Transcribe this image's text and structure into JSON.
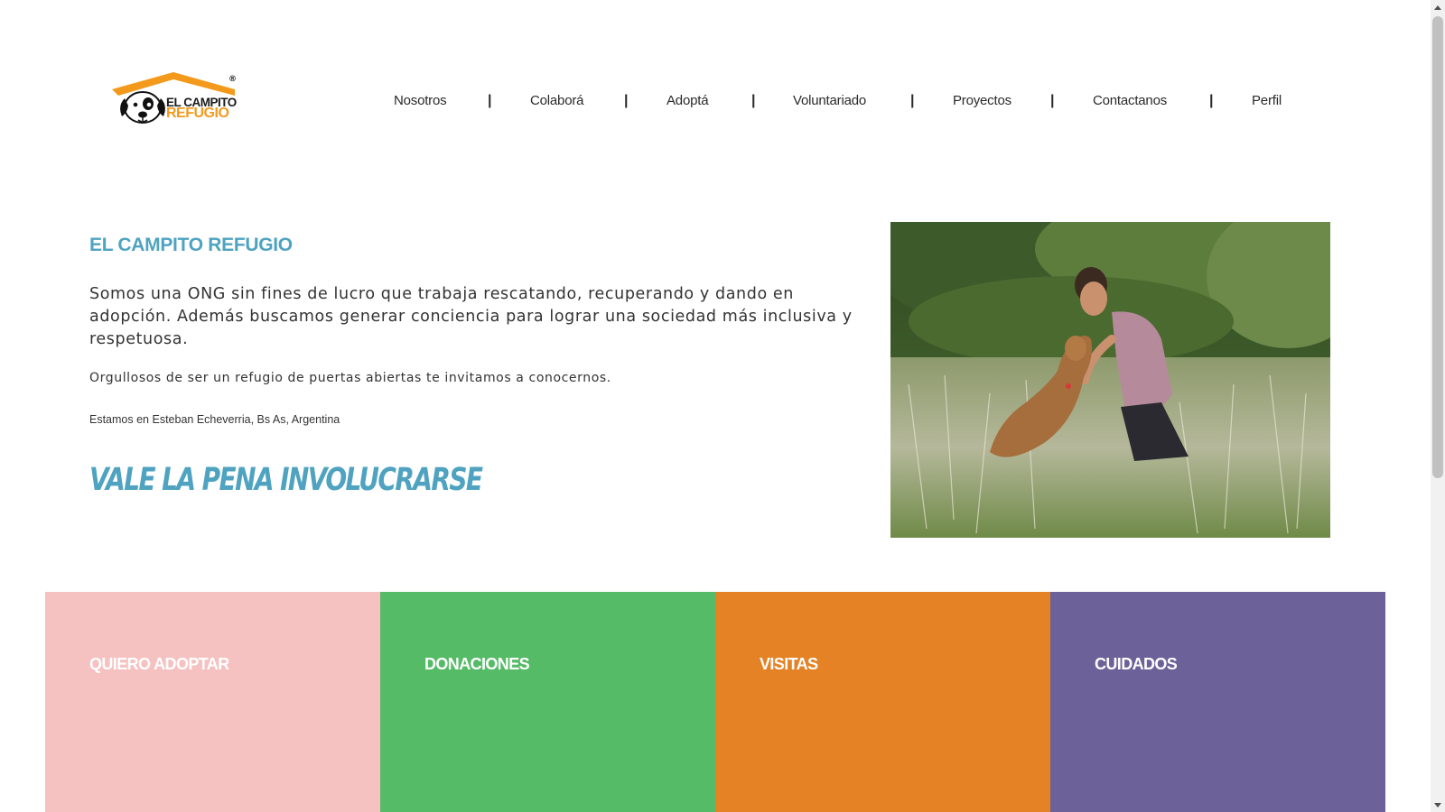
{
  "brand": {
    "line1": "EL CAMPITO",
    "line2": "REFUGIO",
    "registered": "®"
  },
  "nav": {
    "items": [
      {
        "label": "Nosotros"
      },
      {
        "label": "Colaborá"
      },
      {
        "label": "Adoptá"
      },
      {
        "label": "Voluntariado"
      },
      {
        "label": "Proyectos"
      },
      {
        "label": "Contactanos"
      },
      {
        "label": "Perfil"
      }
    ],
    "separator": "|"
  },
  "hero": {
    "title": "EL CAMPITO REFUGIO",
    "lead": "Somos una ONG sin fines de lucro que trabaja rescatando, recuperando y dando en adopción. Además buscamos generar conciencia para lograr una sociedad más inclusiva y respetuosa.",
    "sub": "Orgullosos de ser un refugio de puertas abiertas te invitamos a conocernos.",
    "location": "Estamos en Esteban Echeverria, Bs As, Argentina",
    "slogan": "VALE LA PENA INVOLUCRARSE"
  },
  "tiles": [
    {
      "label": "QUIERO ADOPTAR",
      "color": "#f5c1c1"
    },
    {
      "label": "DONACIONES",
      "color": "#55bb67"
    },
    {
      "label": "VISITAS",
      "color": "#e58225"
    },
    {
      "label": "CUIDADOS",
      "color": "#6c6198"
    }
  ],
  "colors": {
    "accent": "#4fa3c1",
    "logo_orange": "#f39a1c"
  },
  "icons": {
    "logo": "dog-house-logo-icon",
    "scroll_up": "triangle-up-icon",
    "scroll_down": "triangle-down-icon"
  }
}
